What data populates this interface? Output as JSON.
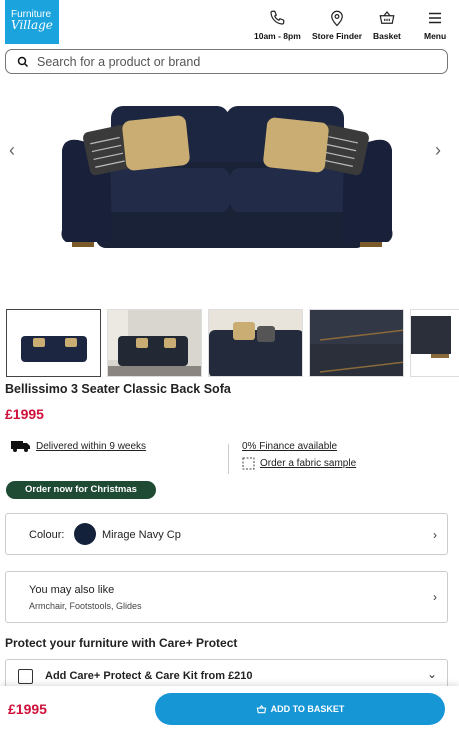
{
  "header": {
    "logo_line1": "Furniture",
    "logo_line2": "Village",
    "nav": {
      "hours_label": "10am - 8pm",
      "store_finder_label": "Store Finder",
      "basket_label": "Basket",
      "menu_label": "Menu"
    },
    "icons": [
      "phone-icon",
      "map-pin-icon",
      "basket-icon",
      "menu-icon"
    ]
  },
  "search": {
    "placeholder": "Search for a product or brand"
  },
  "gallery": {
    "prev_icon": "chevron-left-icon",
    "next_icon": "chevron-right-icon",
    "thumbnail_count_visible": 5
  },
  "product": {
    "title": "Bellissimo 3 Seater Classic Back Sofa",
    "price": "£1995",
    "delivery": "Delivered within 9 weeks",
    "finance": "0% Finance available",
    "fabric_sample": "Order a fabric sample",
    "badge": "Order now for Christmas"
  },
  "colour": {
    "label": "Colour:",
    "value": "Mirage Navy Cp",
    "swatch_color": "#14213a"
  },
  "also_like": {
    "title": "You may also like",
    "items": "Armchair, Footstools, Glides"
  },
  "protect": {
    "heading": "Protect your furniture with Care+ Protect",
    "option_label": "Add Care+ Protect & Care Kit from £210"
  },
  "footer": {
    "price": "£1995",
    "add_button": "ADD TO BASKET"
  },
  "colors": {
    "brand_blue": "#1aa3dd",
    "price_red": "#d0103a",
    "badge_green": "#1f4a33",
    "button_blue": "#1796d6"
  }
}
